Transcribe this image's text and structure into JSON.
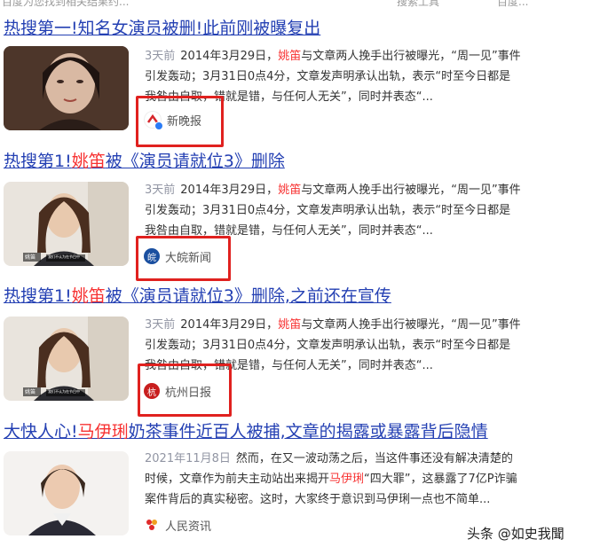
{
  "top_strip": {
    "left_text": "百度为您找到相关结果约...",
    "mid_text": "搜索工具",
    "right_text": "百度..."
  },
  "results": [
    {
      "title_parts": [
        "热搜第一!知名女演员被删!此前刚被曝复出",
        "",
        ""
      ],
      "time": "3天前",
      "snippet_line1": [
        "2014年3月29日，",
        "",
        "与文章两人挽手出行被曝光，“周一见”事件"
      ],
      "snippet_line1_pre": "",
      "snippet_line2": "引发轰动；3月31日0点4分，文章发声明承认出轨，表示“时至今日都是",
      "snippet_line3": "我咎由自取，错就是错，与任何人无关”，同时并表态“...",
      "source": "新晚报",
      "highlight": "姚笛"
    },
    {
      "title_pre": "热搜第1!",
      "title_hl": "姚笛",
      "title_post": "被《演员请就位3》删除",
      "time": "3天前",
      "s1_pre": "2014年3月29日，",
      "s1_hl": "姚笛",
      "s1_post": "与文章两人挽手出行被曝光，“周一见”事件",
      "s2": "引发轰动；3月31日0点4分，文章发声明承认出轨，表示“时至今日都是",
      "s3": "我咎由自取，错就是错，与任何人无关”，同时并表态“...",
      "source": "大皖新闻",
      "thumb_caption1": "姚笛",
      "thumb_caption2": "我们不认为在节目中"
    },
    {
      "title_pre": "热搜第1!",
      "title_hl": "姚笛",
      "title_post": "被《演员请就位3》删除,之前还在宣传",
      "time": "3天前",
      "s1_pre": "2014年3月29日，",
      "s1_hl": "姚笛",
      "s1_post": "与文章两人挽手出行被曝光，“周一见”事件",
      "s2": "引发轰动；3月31日0点4分，文章发声明承认出轨，表示“时至今日都是",
      "s3": "我咎由自取，错就是错，与任何人无关”，同时并表态“...",
      "source": "杭州日报",
      "thumb_caption1": "姚笛",
      "thumb_caption2": "我们不认为在节目中"
    },
    {
      "title_pre": "大快人心!",
      "title_hl": "马伊琍",
      "title_post": "奶茶事件近百人被捕,文章的揭露或暴露背后隐情",
      "time": "2021年11月8日",
      "s1_text": "然而，在又一波动荡之后，当这件事还没有解决清楚的",
      "s2_pre": "时候，文章作为前夫主动站出来揭开",
      "s2_hl": "马伊琍",
      "s2_post": "“四大罪”，这暴露了7亿P诈骗",
      "s3": "案件背后的真实秘密。这时，大家终于意识到马伊琍一点也不简单...",
      "source": "人民资讯"
    }
  ],
  "first": {
    "title": "热搜第一!知名女演员被删!此前刚被曝复出",
    "time": "3天前",
    "s1_pre": "2014年3月29日，",
    "s1_hl": "姚笛",
    "s1_post": "与文章两人挽手出行被曝光，“周一见”事件",
    "s2": "引发轰动；3月31日0点4分，文章发声明承认出轨，表示“时至今日都是",
    "s3": "我咎由自取，错就是错，与任何人无关”，同时并表态“...",
    "source": "新晚报"
  },
  "watermark": "头条 @如史我聞",
  "colors": {
    "title_link": "#2440b3",
    "highlight": "#f73131",
    "red_box": "#e0211f",
    "meta_gray": "#9195a3"
  }
}
